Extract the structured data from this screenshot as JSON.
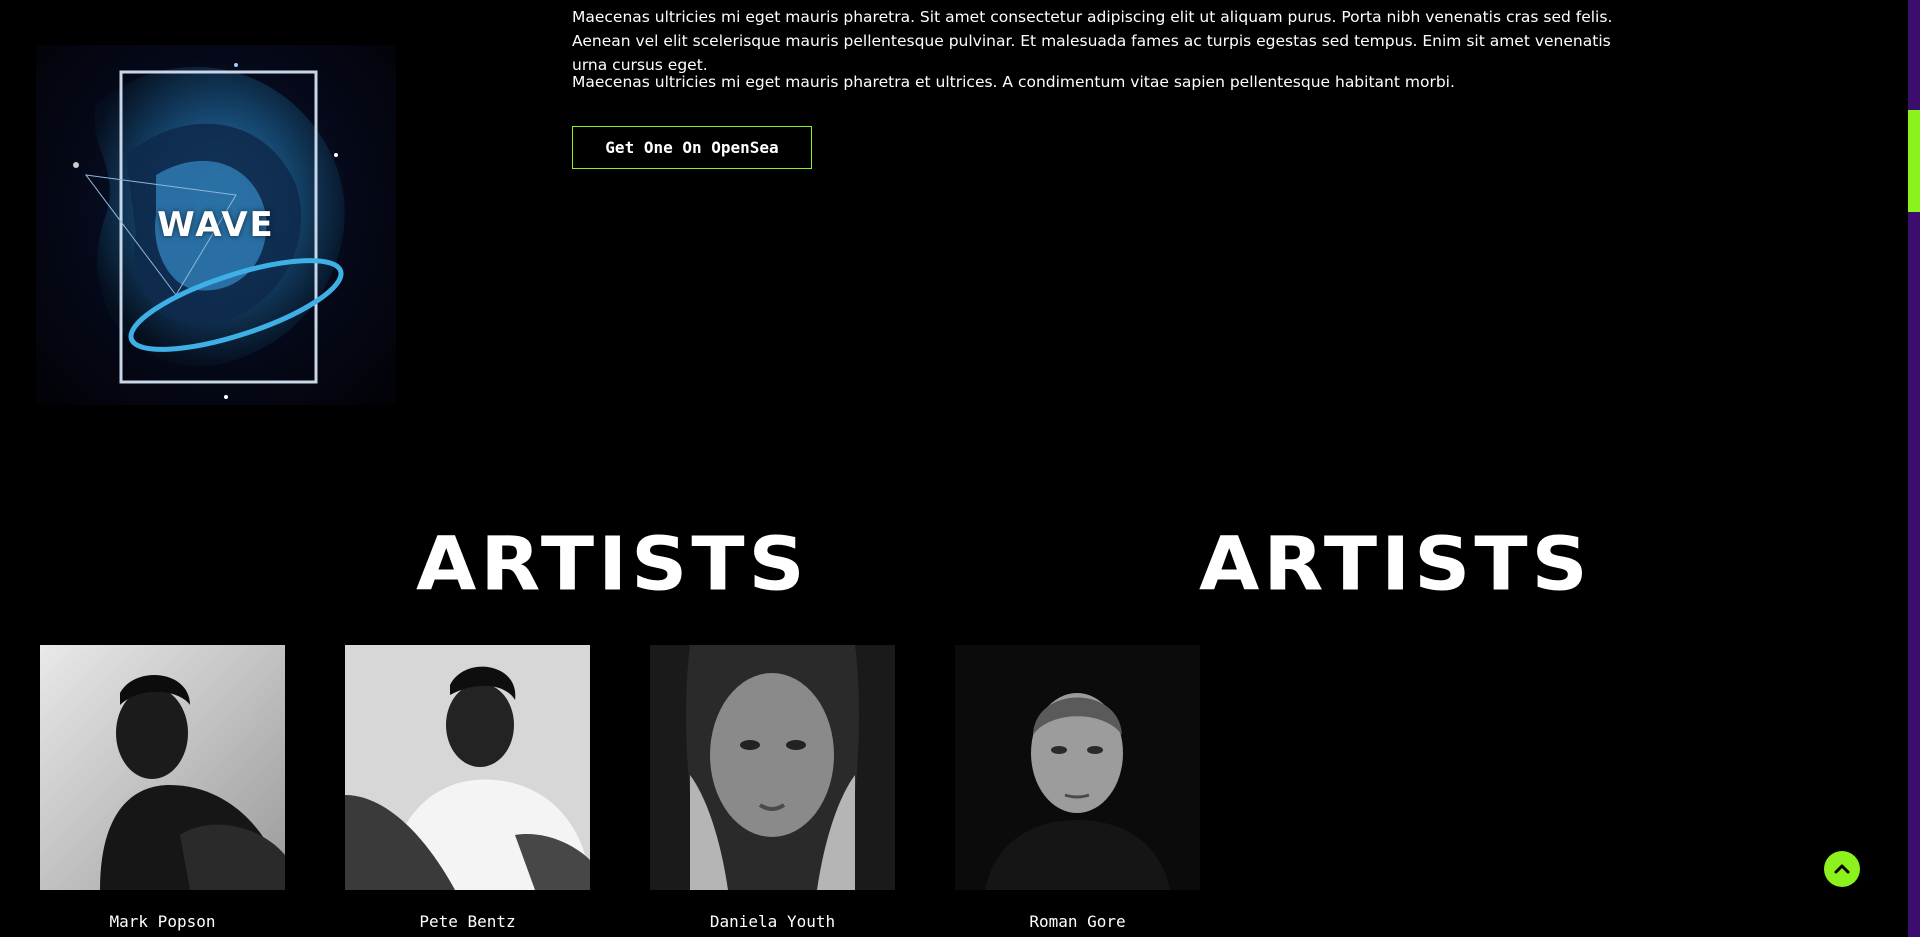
{
  "artwork": {
    "title": "WAVE"
  },
  "about": {
    "paragraph1": "Maecenas ultricies mi eget mauris pharetra. Sit amet consectetur adipiscing elit ut aliquam purus. Porta nibh venenatis cras sed felis. Aenean vel elit scelerisque mauris pellentesque pulvinar. Et malesuada fames ac turpis egestas sed tempus. Enim sit amet venenatis urna cursus eget.",
    "paragraph2": "Maecenas ultricies mi eget mauris pharetra et ultrices. A condimentum vitae sapien pellentesque habitant morbi.",
    "cta_label": "Get One On OpenSea"
  },
  "artists_section": {
    "heading_partial": "S",
    "heading": "ARTISTS",
    "artists": [
      {
        "name": "Mark Popson"
      },
      {
        "name": "Pete Bentz"
      },
      {
        "name": "Daniela Youth"
      },
      {
        "name": "Roman Gore"
      }
    ]
  },
  "icons": {
    "scroll_top": "chevron-up-icon"
  },
  "colors": {
    "accent": "#8bf21d",
    "scroll_track": "#3a0d6e",
    "background": "#000000"
  }
}
